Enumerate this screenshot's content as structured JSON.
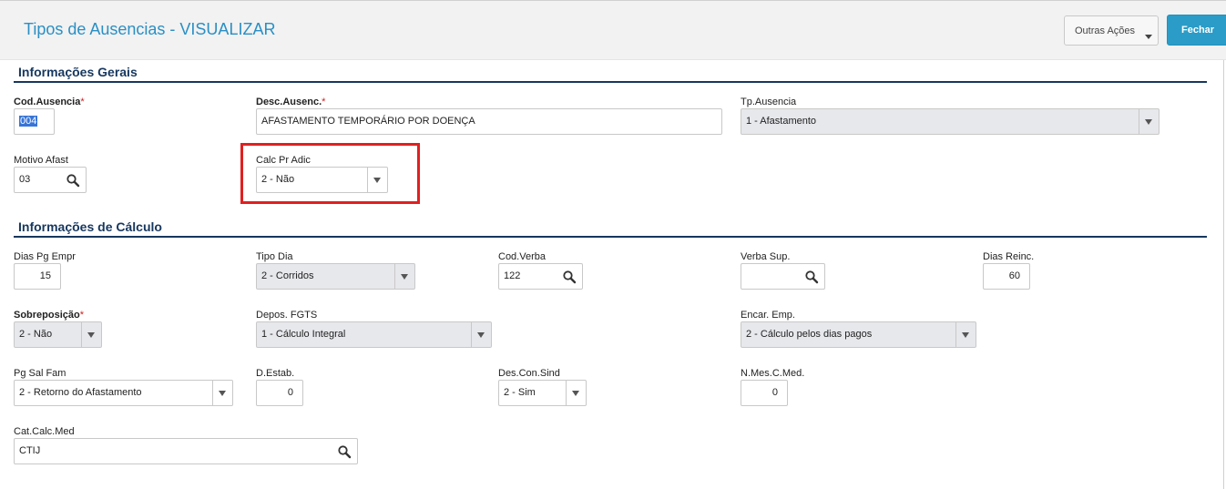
{
  "header": {
    "title": "Tipos de Ausencias - VISUALIZAR",
    "outras_acoes": "Outras Ações",
    "fechar": "Fechar"
  },
  "sections": {
    "gerais": "Informações Gerais",
    "calculo": "Informações de Cálculo"
  },
  "fields": {
    "cod_ausencia": {
      "label": "Cod.Ausencia",
      "required": "*",
      "value": "004"
    },
    "desc_ausenc": {
      "label": "Desc.Ausenc.",
      "required": "*",
      "value": "AFASTAMENTO TEMPORÁRIO POR DOENÇA"
    },
    "tp_ausencia": {
      "label": "Tp.Ausencia",
      "value": "1 - Afastamento"
    },
    "motivo_afast": {
      "label": "Motivo Afast",
      "value": "03"
    },
    "calc_pr_adic": {
      "label": "Calc Pr Adic",
      "value": "2 - Não"
    },
    "dias_pg_empr": {
      "label": "Dias Pg Empr",
      "value": "15"
    },
    "tipo_dia": {
      "label": "Tipo Dia",
      "value": "2 - Corridos"
    },
    "cod_verba": {
      "label": "Cod.Verba",
      "value": "122"
    },
    "verba_sup": {
      "label": "Verba Sup.",
      "value": ""
    },
    "dias_reinc": {
      "label": "Dias Reinc.",
      "value": "60"
    },
    "sobreposicao": {
      "label": "Sobreposição",
      "required": "*",
      "value": "2 - Não"
    },
    "depos_fgts": {
      "label": "Depos. FGTS",
      "value": "1 - Cálculo Integral"
    },
    "encar_emp": {
      "label": "Encar. Emp.",
      "value": "2 - Cálculo pelos dias pagos"
    },
    "pg_sal_fam": {
      "label": "Pg Sal Fam",
      "value": "2 - Retorno do Afastamento"
    },
    "d_estab": {
      "label": "D.Estab.",
      "value": "0"
    },
    "des_con_sind": {
      "label": "Des.Con.Sind",
      "value": "2 - Sim"
    },
    "n_mes_c_med": {
      "label": "N.Mes.C.Med.",
      "value": "0"
    },
    "cat_calc_med": {
      "label": "Cat.Calc.Med",
      "value": "CTIJ"
    }
  },
  "colors": {
    "title": "#2a8fc4",
    "section": "#16375f",
    "primary_button": "#2a9cc7",
    "highlight": "#e02020",
    "required": "#d02020"
  }
}
